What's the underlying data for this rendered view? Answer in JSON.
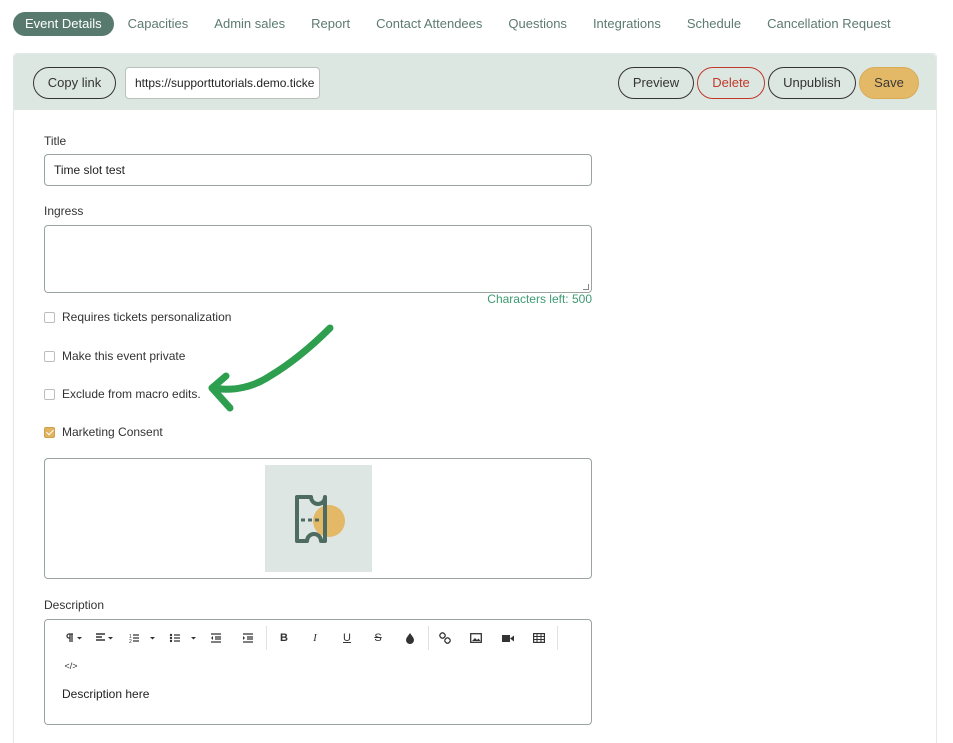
{
  "tabs": [
    {
      "label": "Event Details",
      "active": true
    },
    {
      "label": "Capacities"
    },
    {
      "label": "Admin sales"
    },
    {
      "label": "Report"
    },
    {
      "label": "Contact Attendees"
    },
    {
      "label": "Questions"
    },
    {
      "label": "Integrations"
    },
    {
      "label": "Schedule"
    },
    {
      "label": "Cancellation Request"
    }
  ],
  "toolbar": {
    "copy_link_label": "Copy link",
    "link_value": "https://supporttutorials.demo.ticke",
    "preview_label": "Preview",
    "delete_label": "Delete",
    "unpublish_label": "Unpublish",
    "save_label": "Save"
  },
  "form": {
    "title_label": "Title",
    "title_value": "Time slot test",
    "ingress_label": "Ingress",
    "ingress_value": "",
    "chars_left": "Characters left: 500",
    "checkboxes": [
      {
        "label": "Requires tickets personalization",
        "checked": false
      },
      {
        "label": "Make this event private",
        "checked": false
      },
      {
        "label": "Exclude from macro edits.",
        "checked": false
      },
      {
        "label": "Marketing Consent",
        "checked": true
      }
    ],
    "description_label": "Description",
    "description_value": "Description here"
  },
  "editor_toolbar": {
    "icons": [
      "paragraph-icon",
      "align-icon",
      "ordered-list-icon",
      "unordered-list-icon",
      "outdent-icon",
      "indent-icon",
      "bold-icon",
      "italic-icon",
      "underline-icon",
      "strikethrough-icon",
      "color-icon",
      "link-icon",
      "image-icon",
      "video-icon",
      "table-icon",
      "code-view-icon"
    ],
    "glyphs": {
      "bold": "B",
      "italic": "I",
      "underline": "U",
      "strike": "S",
      "code": "</>"
    }
  },
  "colors": {
    "accent": "#587a6e",
    "panel_bar": "#dde7e2",
    "save": "#e3b866",
    "delete": "#c0392b",
    "chars_left": "#3f9a72",
    "annotation_arrow": "#2e9e4f"
  }
}
